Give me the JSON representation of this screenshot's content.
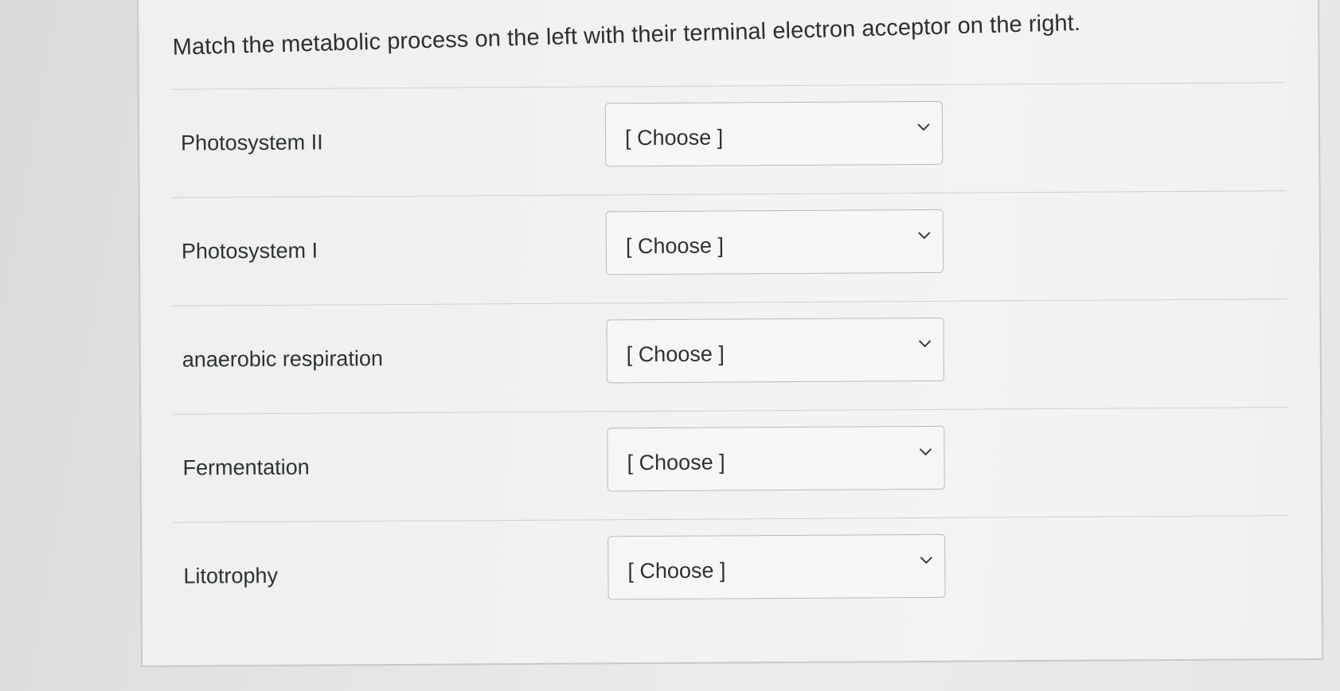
{
  "question": {
    "text": "Match the metabolic process on the left with their terminal electron acceptor on the right."
  },
  "rows": [
    {
      "label": "Photosystem II",
      "selected": "[ Choose ]"
    },
    {
      "label": "Photosystem I",
      "selected": "[ Choose ]"
    },
    {
      "label": "anaerobic respiration",
      "selected": "[ Choose ]"
    },
    {
      "label": "Fermentation",
      "selected": "[ Choose ]"
    },
    {
      "label": "Litotrophy",
      "selected": "[ Choose ]"
    }
  ],
  "icons": {
    "dropdown": "chevron-down-icon"
  },
  "colors": {
    "background": "#e4e5e3",
    "card": "#f1f1ef",
    "border": "#c9cac8",
    "text": "#2b3238"
  }
}
